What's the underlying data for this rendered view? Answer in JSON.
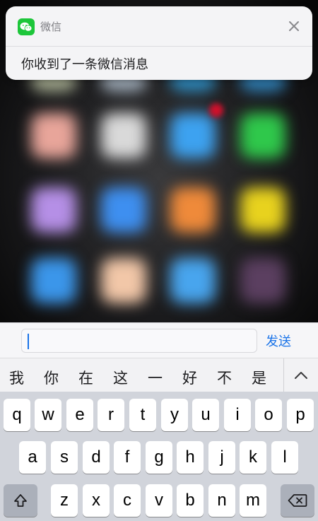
{
  "notification": {
    "app_name": "微信",
    "message": "你收到了一条微信消息",
    "close_icon": "close-icon",
    "app_icon": "wechat-icon",
    "app_icon_color": "#1dc63a"
  },
  "reply": {
    "placeholder": "",
    "value": "",
    "send_label": "发送",
    "accent": "#1a73e8"
  },
  "candidates": {
    "items": [
      "我",
      "你",
      "在",
      "这",
      "一",
      "好",
      "不",
      "是"
    ],
    "collapse_icon": "chevron-up-icon"
  },
  "keyboard": {
    "row1": [
      "q",
      "w",
      "e",
      "r",
      "t",
      "y",
      "u",
      "i",
      "o",
      "p"
    ],
    "row2": [
      "a",
      "s",
      "d",
      "f",
      "g",
      "h",
      "j",
      "k",
      "l"
    ],
    "row3": [
      "z",
      "x",
      "c",
      "v",
      "b",
      "n",
      "m"
    ],
    "shift_icon": "shift-icon",
    "backspace_icon": "backspace-icon"
  }
}
